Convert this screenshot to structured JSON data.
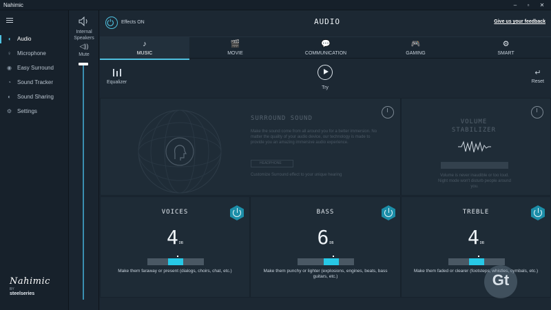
{
  "window": {
    "title": "Nahimic"
  },
  "sidebar": {
    "items": [
      {
        "label": "Audio",
        "icon": "audio-wave-icon",
        "active": true
      },
      {
        "label": "Microphone",
        "icon": "microphone-icon",
        "active": false
      },
      {
        "label": "Easy Surround",
        "icon": "surround-icon",
        "active": false
      },
      {
        "label": "Sound Tracker",
        "icon": "tracker-icon",
        "active": false
      },
      {
        "label": "Sound Sharing",
        "icon": "share-icon",
        "active": false
      },
      {
        "label": "Settings",
        "icon": "gear-icon",
        "active": false
      }
    ],
    "brand": {
      "logo": "Nahimic",
      "by": "BY",
      "maker": "steelseries"
    }
  },
  "volume": {
    "device_label": "Internal Speakers",
    "mute_label": "Mute",
    "level": 1.0
  },
  "header": {
    "effects_label": "Effects ON",
    "title": "AUDIO",
    "feedback_label": "Give us your feedback"
  },
  "tabs": [
    {
      "label": "MUSIC",
      "icon": "music-note-icon",
      "active": true
    },
    {
      "label": "MOVIE",
      "icon": "clapperboard-icon",
      "active": false
    },
    {
      "label": "COMMUNICATION",
      "icon": "chat-bubbles-icon",
      "active": false
    },
    {
      "label": "GAMING",
      "icon": "gamepad-icon",
      "active": false
    },
    {
      "label": "SMART",
      "icon": "smart-brain-icon",
      "active": false
    }
  ],
  "toolbar": {
    "equalizer_label": "Equalizer",
    "try_label": "Try",
    "reset_label": "Reset"
  },
  "surround": {
    "title": "SURROUND SOUND",
    "description": "Make the sound come from all around you for a better immersion. No matter the quality of your audio device, our technology is made to provide you an amazing immersive audio experience.",
    "badge": "HEADPHONE",
    "link": "Customize Surround effect to your unique hearing"
  },
  "stabilizer": {
    "title_line1": "VOLUME",
    "title_line2": "STABILIZER",
    "description": "Volume is never inaudible or too loud. Night mode won't disturb people around you."
  },
  "knobs": [
    {
      "title": "VOICES",
      "value": "4",
      "unit": "DB",
      "level": 0.5,
      "description": "Make them faraway or present (dialogs, choirs, chat, etc.)"
    },
    {
      "title": "BASS",
      "value": "6",
      "unit": "DB",
      "level": 0.6,
      "description": "Make them punchy or lighter (explosions, engines, beats, bass guitars, etc.)"
    },
    {
      "title": "TREBLE",
      "value": "4",
      "unit": "DB",
      "level": 0.5,
      "description": "Make them faded or clearer (footsteps, whistles, cymbals, etc.)"
    }
  ],
  "watermark": {
    "text": "Gt"
  },
  "colors": {
    "accent": "#27c8e6",
    "background": "#1c2833",
    "sidebar": "#17212b"
  }
}
